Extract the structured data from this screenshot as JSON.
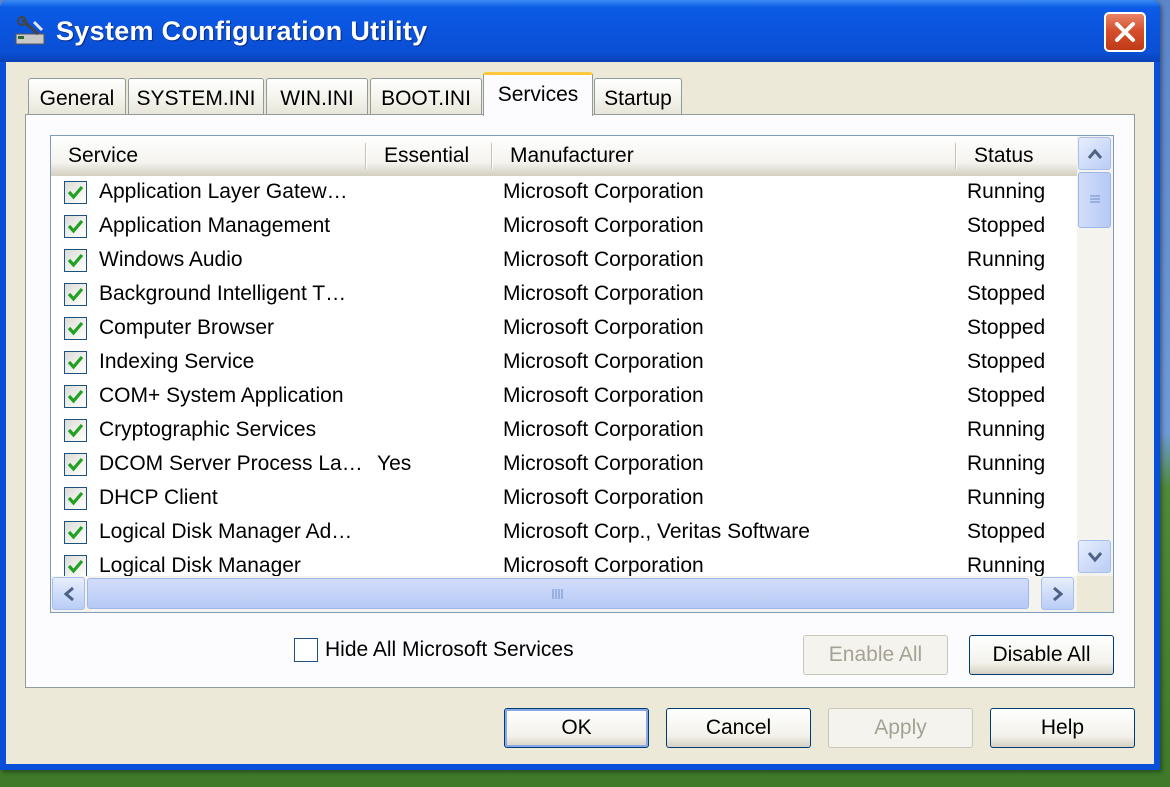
{
  "window": {
    "title": "System Configuration Utility"
  },
  "tabs": [
    {
      "label": "General"
    },
    {
      "label": "SYSTEM.INI"
    },
    {
      "label": "WIN.INI"
    },
    {
      "label": "BOOT.INI"
    },
    {
      "label": "Services",
      "active": true
    },
    {
      "label": "Startup"
    }
  ],
  "columns": {
    "service": "Service",
    "essential": "Essential",
    "manufacturer": "Manufacturer",
    "status": "Status"
  },
  "services": [
    {
      "checked": true,
      "service": "Application Layer Gatew…",
      "essential": "",
      "manufacturer": "Microsoft Corporation",
      "status": "Running"
    },
    {
      "checked": true,
      "service": "Application Management",
      "essential": "",
      "manufacturer": "Microsoft Corporation",
      "status": "Stopped"
    },
    {
      "checked": true,
      "service": "Windows Audio",
      "essential": "",
      "manufacturer": "Microsoft Corporation",
      "status": "Running"
    },
    {
      "checked": true,
      "service": "Background Intelligent T…",
      "essential": "",
      "manufacturer": "Microsoft Corporation",
      "status": "Stopped"
    },
    {
      "checked": true,
      "service": "Computer Browser",
      "essential": "",
      "manufacturer": "Microsoft Corporation",
      "status": "Stopped"
    },
    {
      "checked": true,
      "service": "Indexing Service",
      "essential": "",
      "manufacturer": "Microsoft Corporation",
      "status": "Stopped"
    },
    {
      "checked": true,
      "service": "COM+ System Application",
      "essential": "",
      "manufacturer": "Microsoft Corporation",
      "status": "Stopped"
    },
    {
      "checked": true,
      "service": "Cryptographic Services",
      "essential": "",
      "manufacturer": "Microsoft Corporation",
      "status": "Running"
    },
    {
      "checked": true,
      "service": "DCOM Server Process La…",
      "essential": "Yes",
      "manufacturer": "Microsoft Corporation",
      "status": "Running"
    },
    {
      "checked": true,
      "service": "DHCP Client",
      "essential": "",
      "manufacturer": "Microsoft Corporation",
      "status": "Running"
    },
    {
      "checked": true,
      "service": "Logical Disk Manager Ad…",
      "essential": "",
      "manufacturer": "Microsoft Corp., Veritas Software",
      "status": "Stopped"
    },
    {
      "checked": true,
      "service": "Logical Disk Manager",
      "essential": "",
      "manufacturer": "Microsoft Corporation",
      "status": "Running"
    }
  ],
  "hide_ms_label": "Hide All Microsoft Services",
  "hide_ms_checked": false,
  "buttons": {
    "enable_all": "Enable All",
    "disable_all": "Disable All",
    "ok": "OK",
    "cancel": "Cancel",
    "apply": "Apply",
    "help": "Help"
  },
  "colors": {
    "title_bar": "#0a54dd",
    "dialog_face": "#ece9d8",
    "check_mark": "#21a121",
    "close_button": "#d6502e"
  }
}
